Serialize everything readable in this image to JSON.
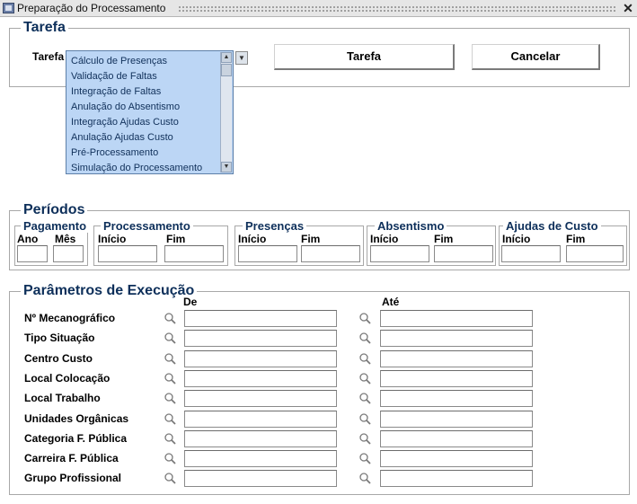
{
  "window": {
    "title": "Preparação do Processamento",
    "close": "✕"
  },
  "tarefa": {
    "frame_title": "Tarefa",
    "label": "Tarefa",
    "options": [
      "Cálculo de Presenças",
      "Validação de Faltas",
      "Integração de Faltas",
      "Anulação do Absentismo",
      "Integração Ajudas Custo",
      "Anulação Ajudas Custo",
      "Pré-Processamento",
      "Simulação do Processamento"
    ],
    "btn_tarefa": "Tarefa",
    "btn_cancelar": "Cancelar"
  },
  "periodos": {
    "frame_title": "Períodos",
    "pagamento": {
      "title": "Pagamento",
      "ano": "Ano",
      "mes": "Mês"
    },
    "processamento": {
      "title": "Processamento",
      "inicio": "Início",
      "fim": "Fim"
    },
    "presencas": {
      "title": "Presenças",
      "inicio": "Início",
      "fim": "Fim"
    },
    "absentismo": {
      "title": "Absentismo",
      "inicio": "Início",
      "fim": "Fim"
    },
    "ajudas": {
      "title": "Ajudas de Custo",
      "inicio": "Início",
      "fim": "Fim"
    }
  },
  "parametros": {
    "frame_title": "Parâmetros de Execução",
    "col_de": "De",
    "col_ate": "Até",
    "rows": [
      "Nº Mecanográfico",
      "Tipo Situação",
      "Centro Custo",
      "Local Colocação",
      "Local Trabalho",
      "Unidades Orgânicas",
      "Categoria F. Pública",
      "Carreira F. Pública",
      "Grupo Profissional"
    ]
  }
}
